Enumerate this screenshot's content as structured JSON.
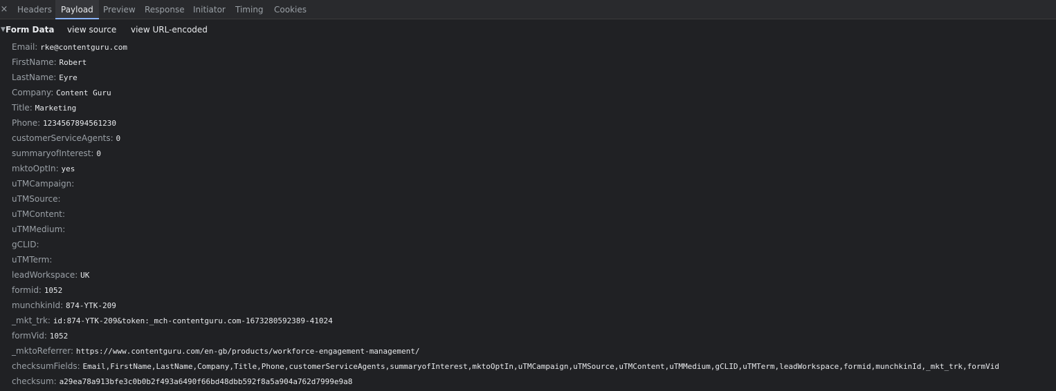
{
  "tabs": {
    "close_label": "×",
    "items": [
      "Headers",
      "Payload",
      "Preview",
      "Response",
      "Initiator",
      "Timing",
      "Cookies"
    ],
    "active": "Payload"
  },
  "form_data": {
    "title": "Form Data",
    "view_source": "view source",
    "view_url_encoded": "view URL-encoded",
    "fields": [
      {
        "key": "Email:",
        "value": "rke@contentguru.com"
      },
      {
        "key": "FirstName:",
        "value": "Robert"
      },
      {
        "key": "LastName:",
        "value": "Eyre"
      },
      {
        "key": "Company:",
        "value": "Content Guru"
      },
      {
        "key": "Title:",
        "value": "Marketing"
      },
      {
        "key": "Phone:",
        "value": "1234567894561230"
      },
      {
        "key": "customerServiceAgents:",
        "value": "0"
      },
      {
        "key": "summaryofInterest:",
        "value": "0"
      },
      {
        "key": "mktoOptIn:",
        "value": "yes"
      },
      {
        "key": "uTMCampaign:",
        "value": ""
      },
      {
        "key": "uTMSource:",
        "value": ""
      },
      {
        "key": "uTMContent:",
        "value": ""
      },
      {
        "key": "uTMMedium:",
        "value": ""
      },
      {
        "key": "gCLID:",
        "value": ""
      },
      {
        "key": "uTMTerm:",
        "value": ""
      },
      {
        "key": "leadWorkspace:",
        "value": "UK"
      },
      {
        "key": "formid:",
        "value": "1052"
      },
      {
        "key": "munchkinId:",
        "value": "874-YTK-209"
      },
      {
        "key": "_mkt_trk:",
        "value": "id:874-YTK-209&token:_mch-contentguru.com-1673280592389-41024"
      },
      {
        "key": "formVid:",
        "value": "1052"
      },
      {
        "key": "_mktoReferrer:",
        "value": "https://www.contentguru.com/en-gb/products/workforce-engagement-management/"
      },
      {
        "key": "checksumFields:",
        "value": "Email,FirstName,LastName,Company,Title,Phone,customerServiceAgents,summaryofInterest,mktoOptIn,uTMCampaign,uTMSource,uTMContent,uTMMedium,gCLID,uTMTerm,leadWorkspace,formid,munchkinId,_mkt_trk,formVid"
      },
      {
        "key": "checksum:",
        "value": "a29ea78a913bfe3c0b0b2f493a6490f66bd48dbb592f8a5a904a762d7999e9a8"
      }
    ]
  }
}
